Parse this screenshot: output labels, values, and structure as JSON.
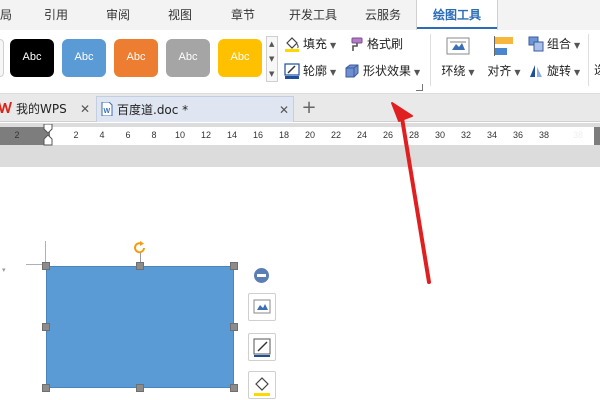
{
  "menu_tabs": [
    {
      "label": "局"
    },
    {
      "label": "引用"
    },
    {
      "label": "审阅"
    },
    {
      "label": "视图"
    },
    {
      "label": "章节"
    },
    {
      "label": "开发工具"
    },
    {
      "label": "云服务"
    },
    {
      "label": "绘图工具"
    }
  ],
  "ribbon": {
    "style_swatches": [
      {
        "label": "Abc",
        "color": "#000000"
      },
      {
        "label": "Abc",
        "color": "#5b9bd5"
      },
      {
        "label": "Abc",
        "color": "#ed7d31"
      },
      {
        "label": "Abc",
        "color": "#a5a5a5"
      },
      {
        "label": "Abc",
        "color": "#ffc000"
      }
    ],
    "fill_label": "填充",
    "format_painter_label": "格式刷",
    "outline_label": "轮廓",
    "shape_effects_label": "形状效果",
    "wrap_label": "环绕",
    "align_label": "对齐",
    "group_label": "组合",
    "rotate_label": "旋转",
    "select_label_partial": "选"
  },
  "doc_tabs": [
    {
      "label": "我的WPS"
    },
    {
      "label": "百度道.doc *"
    }
  ],
  "ruler_numbers": [
    "2",
    "2",
    "4",
    "6",
    "8",
    "10",
    "12",
    "14",
    "16",
    "18",
    "20",
    "22",
    "24",
    "26",
    "28",
    "30",
    "32",
    "34",
    "36",
    "38"
  ],
  "colors": {
    "accent": "#2b6cb6",
    "shape_fill": "#5b9bd5",
    "annotation_arrow": "#e02020",
    "wps_red": "#d9261c",
    "rotate_handle": "#f39c12"
  }
}
